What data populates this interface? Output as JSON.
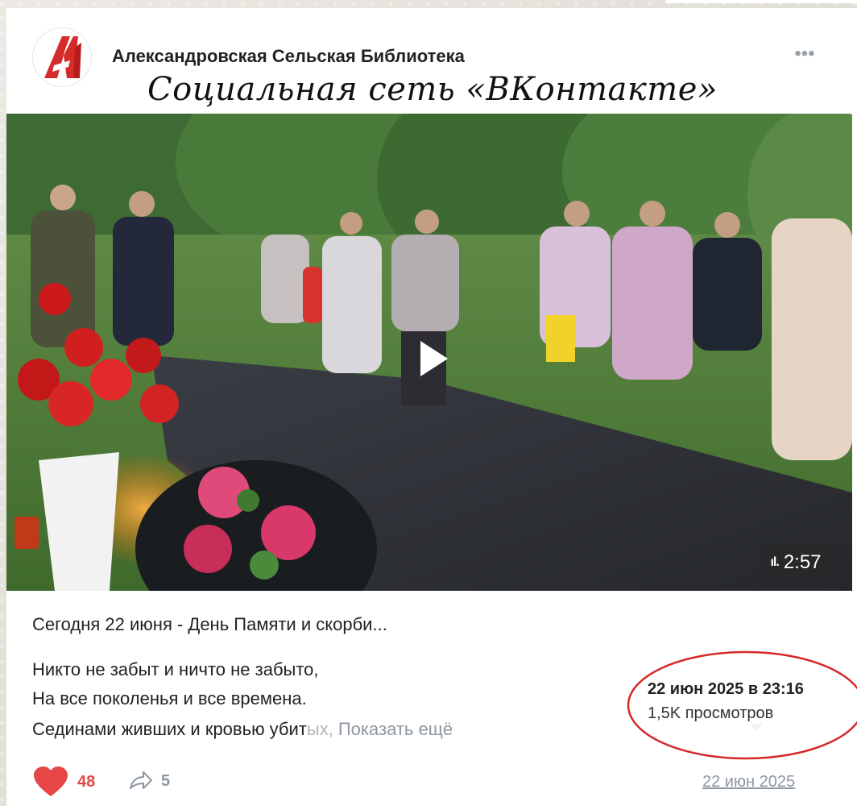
{
  "header": {
    "group_name": "Александровская Сельская Библиотека",
    "subtitle": "Социальная сеть «ВКонтакте»",
    "more_label": "•••"
  },
  "video": {
    "duration": "2:57",
    "quality_icon": "signal-bars-icon",
    "play_icon": "play-icon"
  },
  "post": {
    "headline": "Сегодня 22 июня - День Памяти и скорби...",
    "lines": [
      "Никто не забыт и ничто не забыто,",
      "На все поколенья и все времена.",
      "Сединами живших и кровью убит"
    ],
    "line3_faded": "ых,",
    "show_more": "Показать ещё"
  },
  "tooltip": {
    "date": "22 июн 2025 в 23:16",
    "views": "1,5K просмотров"
  },
  "footer": {
    "likes": "48",
    "shares": "5",
    "date": "22 июн 2025"
  },
  "colors": {
    "like_red": "#e64646",
    "muted_gray": "#8d96a1",
    "annotation_red": "#d62828"
  }
}
